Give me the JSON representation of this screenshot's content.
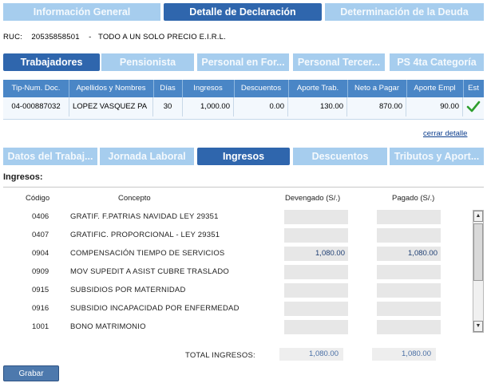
{
  "top_tabs": [
    "Información General",
    "Detalle de Declaración",
    "Determinación de la Deuda"
  ],
  "ruc": {
    "label": "RUC:",
    "number": "20535858501",
    "separator": "-",
    "name": "TODO A UN SOLO PRECIO E.I.R.L."
  },
  "worker_tabs": [
    "Trabajadores",
    "Pensionista",
    "Personal en For...",
    "Personal Tercer...",
    "PS 4ta Categoría"
  ],
  "grid": {
    "headers": [
      "Tip-Num. Doc.",
      "Apellidos y Nombres",
      "Días",
      "Ingresos",
      "Descuentos",
      "Aporte Trab.",
      "Neto a Pagar",
      "Aporte Empl",
      "Est"
    ],
    "rows": [
      [
        "04-000887032",
        "LOPEZ VASQUEZ PA",
        "30",
        "1,000.00",
        "0.00",
        "130.00",
        "870.00",
        "90.00",
        ""
      ]
    ],
    "status_icon": "check-icon",
    "status_color": "#2e9e2e"
  },
  "close_detail_link": "cerrar detalle",
  "detail_tabs": [
    "Datos del Trabaj...",
    "Jornada Laboral",
    "Ingresos",
    "Descuentos",
    "Tributos y Aport..."
  ],
  "ingresos": {
    "section_label": "Ingresos:",
    "headers": {
      "codigo": "Código",
      "concepto": "Concepto",
      "devengado": "Devengado (S/.)",
      "pagado": "Pagado (S/.)"
    },
    "rows": [
      {
        "code": "0406",
        "desc": "GRATIF. F.PATRIAS NAVIDAD LEY 29351",
        "devengado": "",
        "pagado": ""
      },
      {
        "code": "0407",
        "desc": "GRATIFIC. PROPORCIONAL - LEY 29351",
        "devengado": "",
        "pagado": ""
      },
      {
        "code": "0904",
        "desc": "COMPENSACIÓN TIEMPO DE SERVICIOS",
        "devengado": "1,080.00",
        "pagado": "1,080.00"
      },
      {
        "code": "0909",
        "desc": "MOV SUPEDIT A ASIST CUBRE TRASLADO",
        "devengado": "",
        "pagado": ""
      },
      {
        "code": "0915",
        "desc": "SUBSIDIOS POR MATERNIDAD",
        "devengado": "",
        "pagado": ""
      },
      {
        "code": "0916",
        "desc": "SUBSIDIO INCAPACIDAD POR ENFERMEDAD",
        "devengado": "",
        "pagado": ""
      },
      {
        "code": "1001",
        "desc": "BONO MATRIMONIO",
        "devengado": "",
        "pagado": ""
      }
    ],
    "total_label": "TOTAL INGRESOS:",
    "total_devengado": "1,080.00",
    "total_pagado": "1,080.00"
  },
  "grabar_label": "Grabar",
  "scroll_up": "▲",
  "scroll_down": "▼"
}
